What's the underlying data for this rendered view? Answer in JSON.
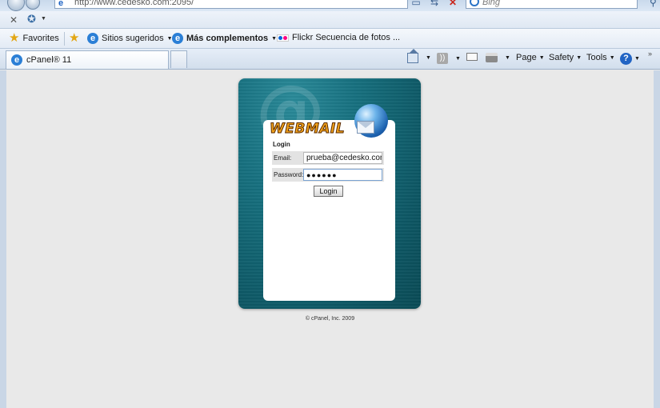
{
  "browser": {
    "address_url": "http://www.cedesko.com:2095/",
    "search_placeholder": "Bing",
    "tab_title": "cPanel® 11"
  },
  "favorites_bar": {
    "favorites_label": "Favorites",
    "items": [
      {
        "label": "Sitios sugeridos"
      },
      {
        "label": "Más complementos"
      },
      {
        "label": "Flickr Secuencia de fotos ..."
      }
    ]
  },
  "command_bar": {
    "page_label": "Page",
    "safety_label": "Safety",
    "tools_label": "Tools"
  },
  "login": {
    "brand": "WEBMAIL",
    "title": "Login",
    "email_label": "Email:",
    "email_value": "prueba@cedesko.com",
    "password_label": "Password:",
    "password_value": "●●●●●●",
    "button_label": "Login",
    "copyright": "© cPanel, Inc. 2009"
  },
  "colors": {
    "panel_teal": "#17707f",
    "brand_orange": "#f2a21a",
    "chrome_blue": "#dfe8f3"
  }
}
